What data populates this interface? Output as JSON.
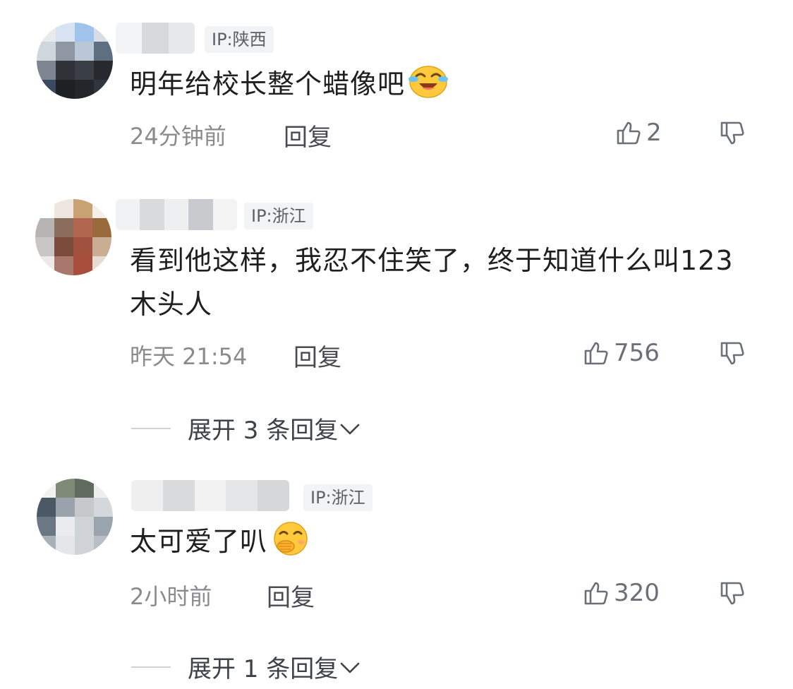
{
  "comments": [
    {
      "ip": "IP:陕西",
      "text": "明年给校长整个蜡像吧",
      "emoji": "laughing-tears-emoji",
      "time": "24分钟前",
      "reply_label": "回复",
      "likes": "2"
    },
    {
      "ip": "IP:浙江",
      "text": "看到他这样，我忍不住笑了，终于知道什么叫123木头人",
      "time": "昨天 21:54",
      "reply_label": "回复",
      "likes": "756",
      "expand_label": "展开 3 条回复"
    },
    {
      "ip": "IP:浙江",
      "text": "太可爱了叭",
      "emoji": "smirking-hand-emoji",
      "time": "2小时前",
      "reply_label": "回复",
      "likes": "320",
      "expand_label": "展开 1 条回复"
    }
  ],
  "icons": {
    "like": "thumbs-up-icon",
    "dislike": "thumbs-down-icon",
    "expand": "chevron-down-icon"
  },
  "colors": {
    "badge_bg": "#f2f3f5",
    "meta_text": "#8a8a8f",
    "emoji_yellow": "#ffc93c"
  }
}
